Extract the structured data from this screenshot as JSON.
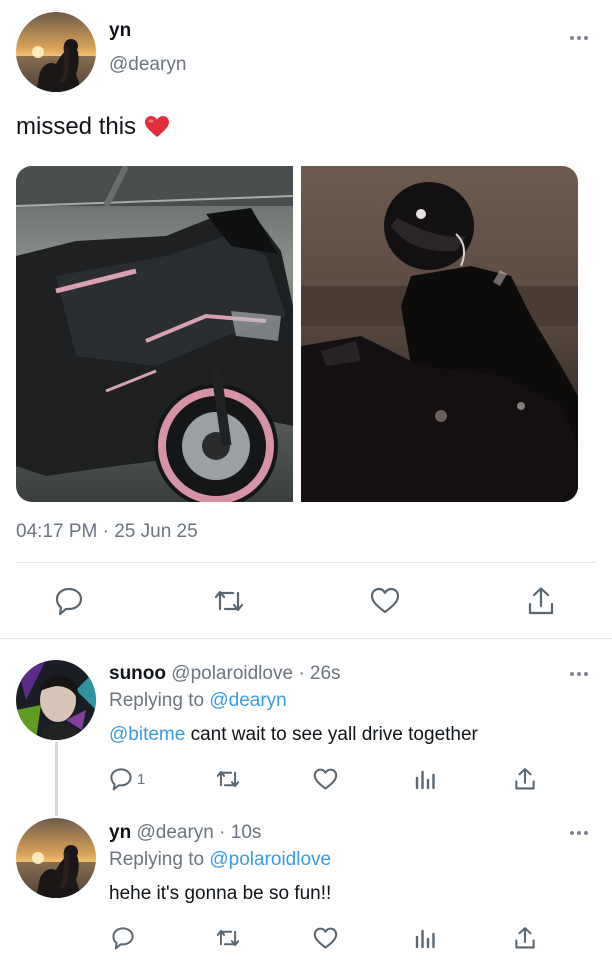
{
  "main_tweet": {
    "display_name": "yn",
    "handle": "@dearyn",
    "text": "missed this",
    "emoji": "❤️",
    "timestamp": "04:17 PM · 25 Jun 25",
    "images": [
      "pink and black sport motorcycle",
      "rider in black helmet on motorcycle at night"
    ]
  },
  "replies": [
    {
      "display_name": "sunoo",
      "handle": "@polaroidlove",
      "time": "· 26s",
      "replying_label": "Replying to",
      "replying_to": "@dearyn",
      "mention": "@biteme",
      "text": " cant wait to see yall drive together",
      "reply_count": "1"
    },
    {
      "display_name": "yn",
      "handle": "@dearyn",
      "time": "· 10s",
      "replying_label": "Replying to",
      "replying_to": "@polaroidlove",
      "text": "hehe it's gonna be so fun!!"
    }
  ],
  "colors": {
    "link": "#3a9be6",
    "muted": "#6b7580",
    "heart": "#e0245e",
    "divider": "#e3e6e9"
  },
  "icons": [
    "more-icon",
    "reply-icon",
    "retweet-icon",
    "like-icon",
    "share-icon",
    "analytics-icon"
  ]
}
